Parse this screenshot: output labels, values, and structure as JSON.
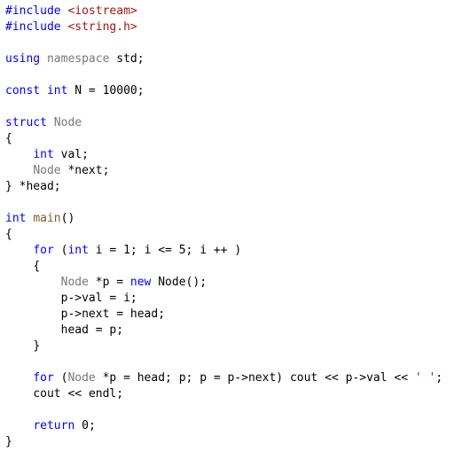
{
  "chart_data": {
    "type": "table",
    "title": "C++ code snippet — singly linked list push-front and traversal",
    "lines": [
      "#include <iostream>",
      "#include <string.h>",
      "",
      "using namespace std;",
      "",
      "const int N = 10000;",
      "",
      "struct Node",
      "{",
      "    int val;",
      "    Node *next;",
      "} *head;",
      "",
      "int main()",
      "{",
      "    for (int i = 1; i <= 5; i ++ )",
      "    {",
      "        Node *p = new Node();",
      "        p->val = i;",
      "        p->next = head;",
      "        head = p;",
      "    }",
      "",
      "    for (Node *p = head; p; p = p->next) cout << p->val << ' ';",
      "    cout << endl;",
      "",
      "    return 0;",
      "}"
    ]
  },
  "t": {
    "hash_include1": "#include",
    "sp": " ",
    "hdr_iostream": "<iostream>",
    "hash_include2": "#include",
    "hdr_string_h": "<string.h>",
    "kw_using": "using",
    "kw_namespace": "namespace",
    "ns_std": "std",
    "semi": ";",
    "kw_const": "const",
    "ty_int": "int",
    "id_N": "N",
    "eq": " = ",
    "num_10000": "10000",
    "kw_struct": "struct",
    "id_Node": "Node",
    "lbrace": "{",
    "rbrace": "}",
    "indent1": "    ",
    "indent2": "        ",
    "id_val": "val",
    "star": "*",
    "id_next": "next",
    "id_head": "head",
    "id_main": "main",
    "lpar": "(",
    "rpar": ")",
    "kw_for": "for",
    "id_i": "i",
    "num_1": "1",
    "le": " <= ",
    "num_5": "5",
    "inc": " ++ ",
    "id_p": "p",
    "kw_new": "new",
    "call_Node": "Node()",
    "arrow": "->",
    "eq2": " = ",
    "id_cout": "cout",
    "shl": " << ",
    "char_space": "' '",
    "id_endl": "endl",
    "kw_return": "return",
    "num_0": "0"
  }
}
